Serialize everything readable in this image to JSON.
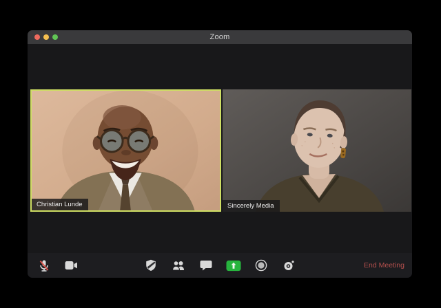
{
  "window": {
    "title": "Zoom",
    "traffic_lights": [
      "close",
      "minimize",
      "fullscreen"
    ]
  },
  "participants": [
    {
      "name": "Christian Lunde",
      "active_speaker": true
    },
    {
      "name": "Sincerely Media",
      "active_speaker": false
    }
  ],
  "toolbar": {
    "icons": [
      "microphone-muted-icon",
      "video-camera-icon",
      "security-shield-icon",
      "participants-icon",
      "chat-bubble-icon",
      "share-screen-icon",
      "record-icon",
      "reactions-timer-icon"
    ],
    "end_meeting_label": "End Meeting"
  },
  "colors": {
    "share_screen_green": "#27b43e",
    "end_meeting_red": "#b5504d",
    "active_speaker_border": "#cede63",
    "traffic_red": "#ed6a5e",
    "traffic_yellow": "#f4bf4f",
    "traffic_green": "#61c555",
    "titlebar_bg": "#3a3a3c",
    "window_bg": "#19191b"
  }
}
